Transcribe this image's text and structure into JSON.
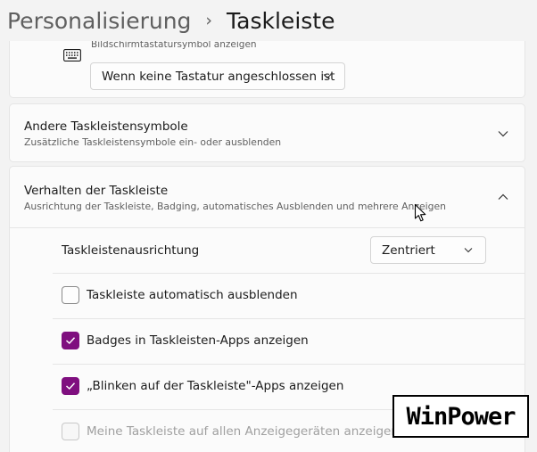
{
  "breadcrumb": {
    "parent": "Personalisierung",
    "separator": "›",
    "current": "Taskleiste"
  },
  "touch_keyboard": {
    "label": "Bildschirmtastatursymbol anzeigen",
    "icon": "keyboard-icon",
    "dropdown_value": "Wenn keine Tastatur angeschlossen ist"
  },
  "other_icons": {
    "title": "Andere Taskleistensymbole",
    "subtitle": "Zusätzliche Taskleistensymbole ein- oder ausblenden",
    "icon": "chevron-down-icon"
  },
  "behavior": {
    "title": "Verhalten der Taskleiste",
    "subtitle": "Ausrichtung der Taskleiste, Badging, automatisches Ausblenden und mehrere Anzeigen",
    "icon": "chevron-up-icon",
    "alignment_label": "Taskleistenausrichtung",
    "alignment_value": "Zentriert",
    "options": [
      {
        "label": "Taskleiste automatisch ausblenden",
        "checked": false,
        "disabled": false
      },
      {
        "label": "Badges in Taskleisten-Apps anzeigen",
        "checked": true,
        "disabled": false
      },
      {
        "label": "„Blinken auf der Taskleiste\"-Apps anzeigen",
        "checked": true,
        "disabled": false
      },
      {
        "label": "Meine Taskleiste auf allen Anzeigegeräten anzeigen",
        "checked": false,
        "disabled": true
      }
    ]
  },
  "colors": {
    "accent": "#7f0f7f",
    "background": "#f3f3f3",
    "card": "#fbfbfb"
  },
  "watermark": {
    "text": "WinPower"
  }
}
